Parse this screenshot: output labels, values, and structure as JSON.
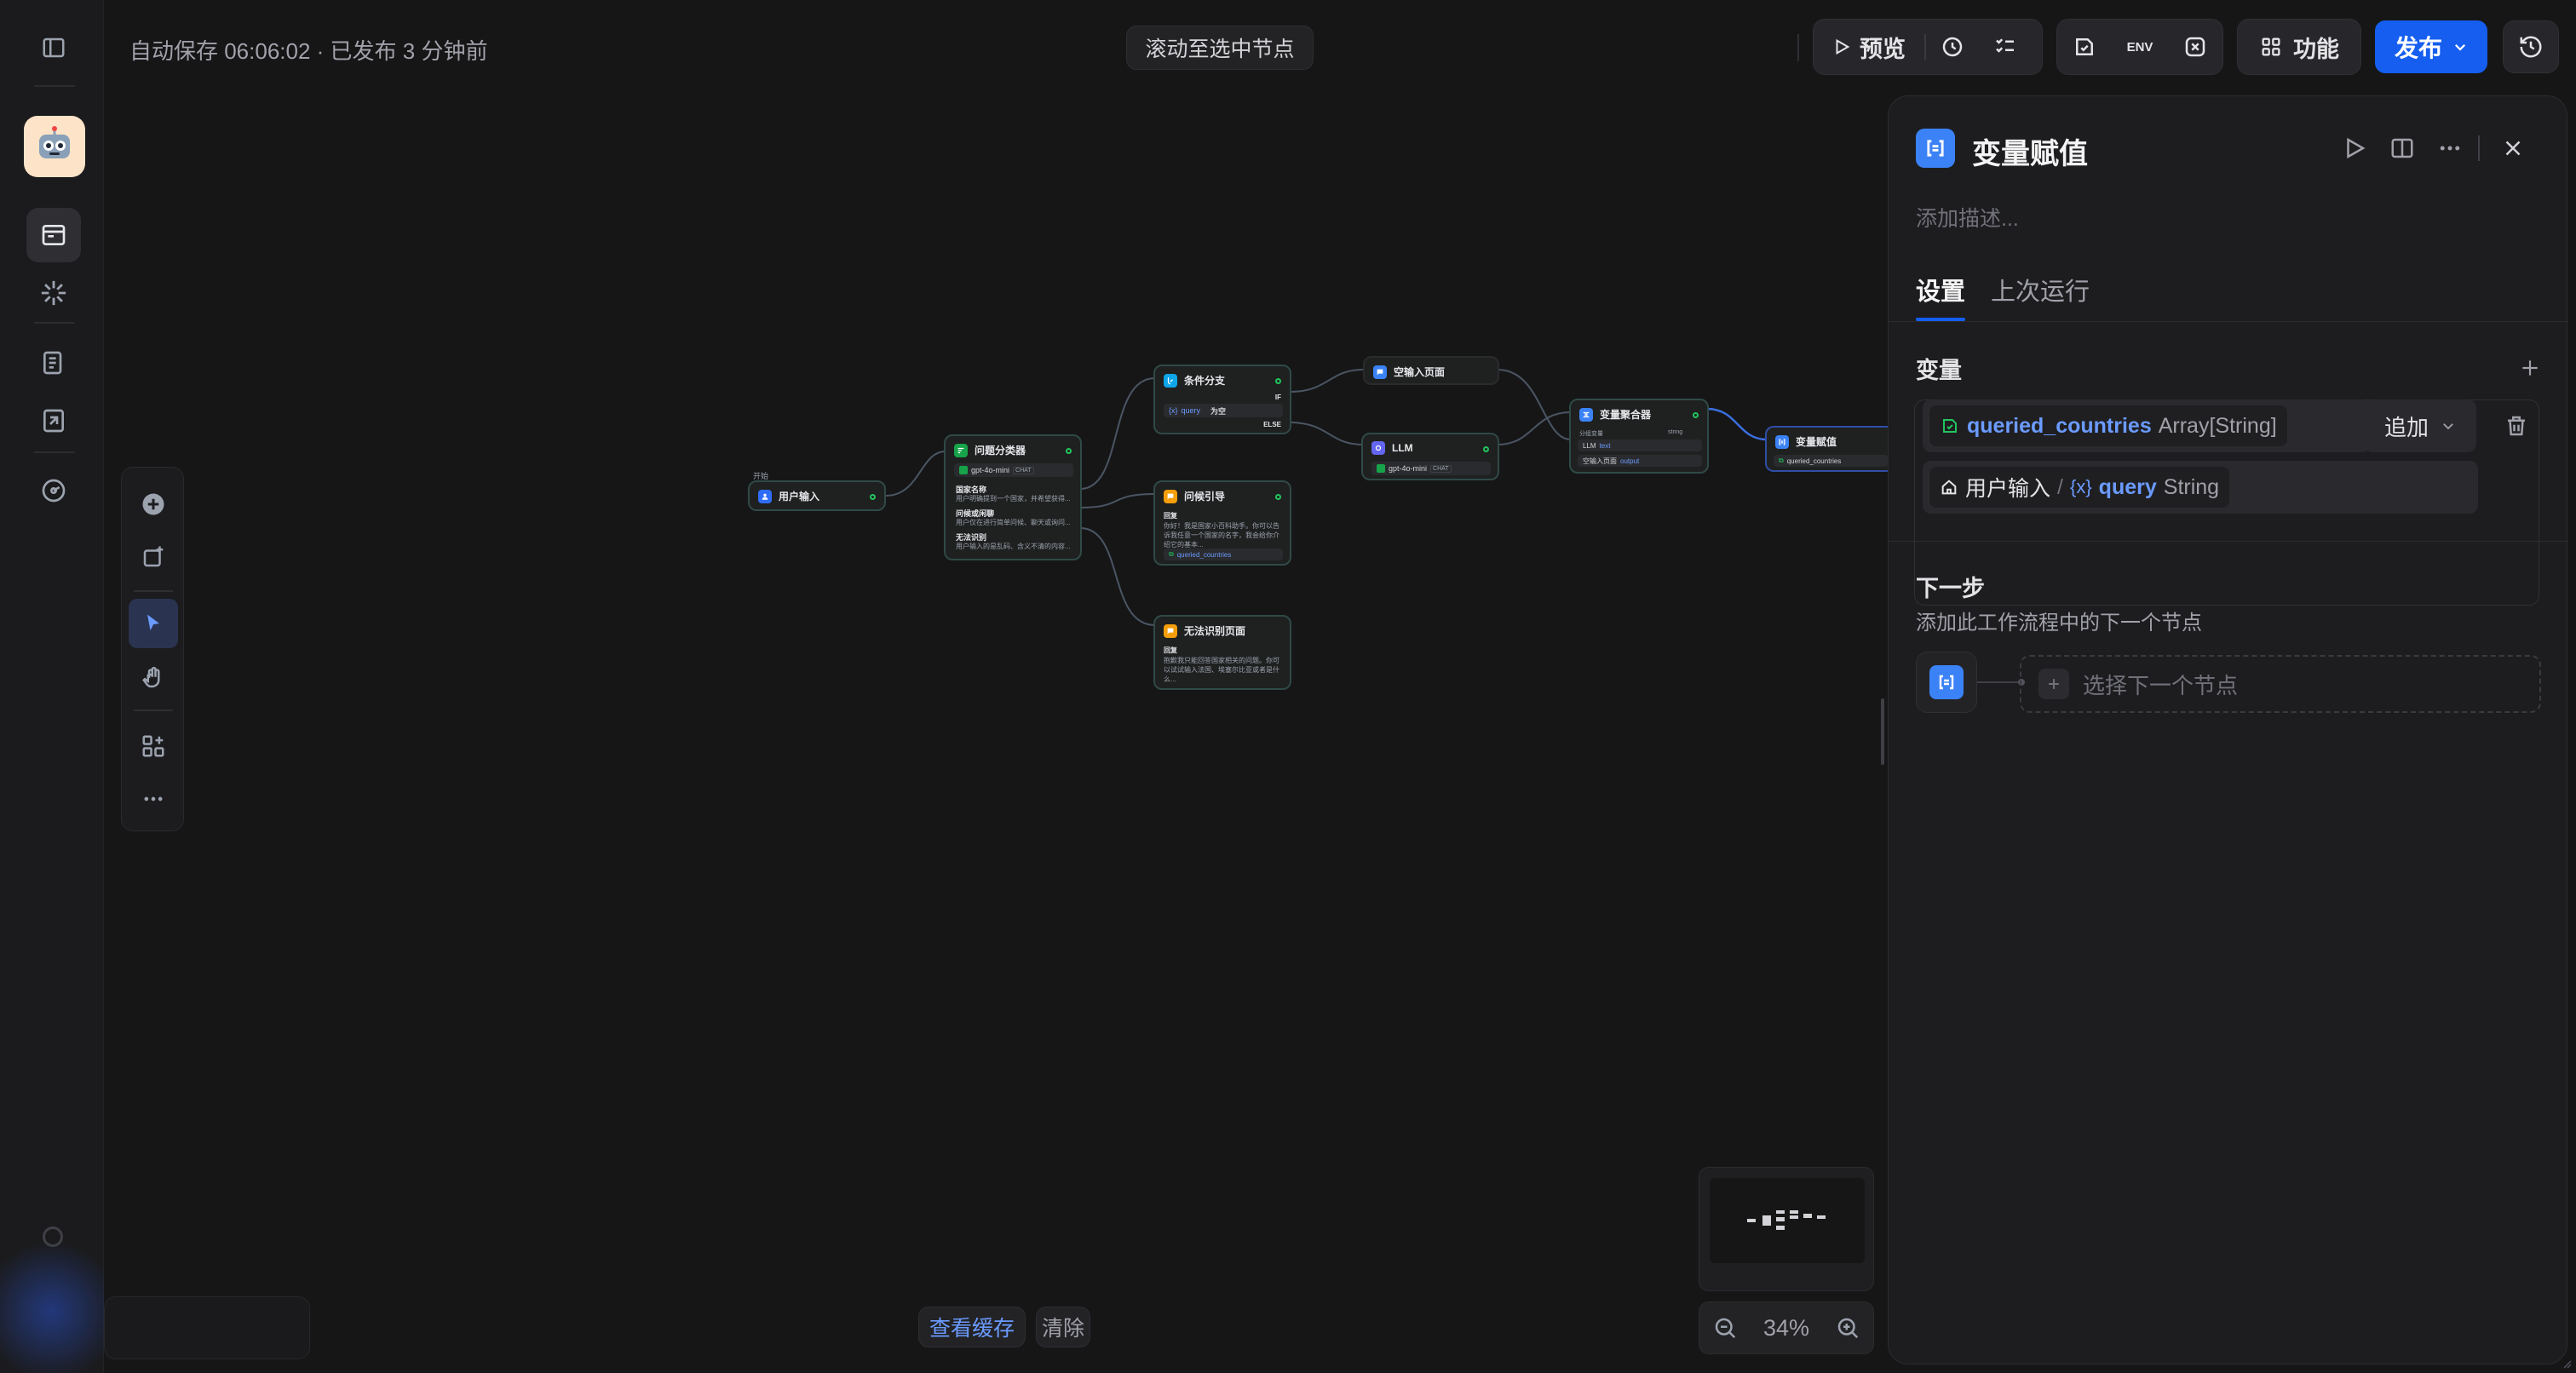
{
  "topbar": {
    "autosave": "自动保存 06:06:02 · 已发布 3 分钟前",
    "scroll_to_node": "滚动至选中节点",
    "preview_label": "预览",
    "env_label": "ENV",
    "features_label": "功能",
    "publish_label": "发布"
  },
  "workflow": {
    "start_caption": "开始",
    "start_node": "用户输入",
    "classifier": {
      "title": "问题分类器",
      "model": "gpt-4o-mini",
      "model_badge": "CHAT",
      "classes": [
        {
          "name": "国家名称",
          "desc": "用户明确提到一个国家，并希望获得..."
        },
        {
          "name": "问候或闲聊",
          "desc": "用户仅在进行简单问候、聊天或询问..."
        },
        {
          "name": "无法识别",
          "desc": "用户输入的是乱码、含义不清的内容..."
        }
      ]
    },
    "if_else": {
      "title": "条件分支",
      "if_label": "IF",
      "var": "query",
      "op": "为空",
      "else_label": "ELSE"
    },
    "empty_reply": {
      "title": "空输入页面"
    },
    "llm": {
      "title": "LLM",
      "model": "gpt-4o-mini",
      "badge": "CHAT"
    },
    "guide": {
      "title": "问候引导",
      "caption": "回复",
      "text": "你好！我是国家小百科助手。你可以告诉我任意一个国家的名字，我会给你介绍它的基本...",
      "var": "queried_countries"
    },
    "unknown": {
      "title": "无法识别页面",
      "caption": "回复",
      "text": "抱歉我只能回答国家相关的问题。你可以试试输入法国、埃塞尔比亚或者是什么..."
    },
    "aggregator": {
      "title": "变量聚合器",
      "group": "分组变量",
      "type": "string",
      "row1_node": "LLM",
      "row1_var": "text",
      "row2_node": "空输入页面",
      "row2_var": "output"
    },
    "assigner": {
      "title": "变量赋值",
      "var": "queried_countries"
    }
  },
  "canvas": {
    "view_cache": "查看缓存",
    "clear": "清除",
    "zoom": "34%"
  },
  "panel": {
    "title": "变量赋值",
    "desc_placeholder": "添加描述...",
    "tabs": [
      "设置",
      "上次运行"
    ],
    "variables_title": "变量",
    "target_var": "queried_countries",
    "target_type": "Array[String]",
    "mode": "追加",
    "source_node": "用户输入",
    "source_sep": "/",
    "source_var": "query",
    "source_type": "String",
    "next_title": "下一步",
    "next_desc": "添加此工作流程中的下一个节点",
    "select_next": "选择下一个节点"
  },
  "colors": {
    "accent": "#155eef",
    "link_blue": "#6b9bff",
    "node_border": "#2f4a46",
    "success": "#22c55e"
  }
}
